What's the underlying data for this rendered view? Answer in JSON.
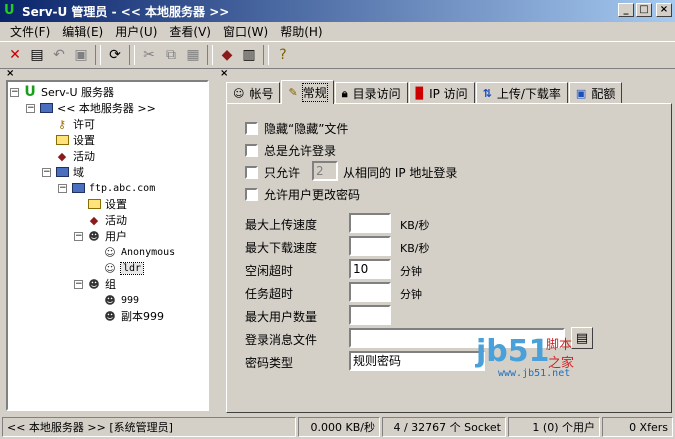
{
  "window": {
    "title": "Serv-U 管理员 - << 本地服务器 >>",
    "min": "_",
    "max": "□",
    "close": "×"
  },
  "menu": [
    "文件(F)",
    "编辑(E)",
    "用户(U)",
    "查看(V)",
    "窗口(W)",
    "帮助(H)"
  ],
  "toolbar": {
    "icons": [
      "delete-icon",
      "new-icon",
      "undo-icon",
      "save-icon",
      "refresh-icon",
      "cut-icon",
      "copy-icon",
      "paste-icon",
      "connect-icon",
      "server-icon",
      "help-icon"
    ]
  },
  "tree": {
    "root": "Serv-U 服务器",
    "local_server": "<< 本地服务器 >>",
    "license": "许可",
    "settings": "设置",
    "activity": "活动",
    "domains": "域",
    "domain_name": "ftp.abc.com",
    "domain_settings": "设置",
    "domain_activity": "活动",
    "users": "用户",
    "user1": "Anonymous",
    "user2": "ldr",
    "groups": "组",
    "group1": "999",
    "group2": "副本999"
  },
  "tabs": [
    {
      "label": "帐号"
    },
    {
      "label": "常规"
    },
    {
      "label": "目录访问"
    },
    {
      "label": "IP 访问",
      "prefix": "IP"
    },
    {
      "label": "上传/下载率"
    },
    {
      "label": "配额"
    }
  ],
  "general": {
    "hide_hidden": "隐藏“隐藏”文件",
    "always_allow": "总是允许登录",
    "only_allow": "只允许",
    "only_allow_value": "2",
    "same_ip": "从相同的 IP 地址登录",
    "allow_change_pw": "允许用户更改密码",
    "max_upload_label": "最大上传速度",
    "max_upload_value": "",
    "max_upload_unit": "KB/秒",
    "max_download_label": "最大下载速度",
    "max_download_value": "",
    "max_download_unit": "KB/秒",
    "idle_timeout_label": "空闲超时",
    "idle_timeout_value": "10",
    "idle_timeout_unit": "分钟",
    "session_timeout_label": "任务超时",
    "session_timeout_value": "",
    "session_timeout_unit": "分钟",
    "max_users_label": "最大用户数量",
    "max_users_value": "",
    "login_msg_label": "登录消息文件",
    "login_msg_value": "",
    "pw_type_label": "密码类型",
    "pw_type_value": "规则密码"
  },
  "watermark": {
    "brand": "jb51",
    "line1": "脚本",
    "line2": "之家",
    "url": "www.jb51.net"
  },
  "status": {
    "server": "<< 本地服务器 >>  [系统管理员]",
    "speed": "0.000 KB/秒",
    "sockets": "4 / 32767 个 Socket",
    "users": "1 (0) 个用户",
    "xfers": "0 Xfers"
  }
}
